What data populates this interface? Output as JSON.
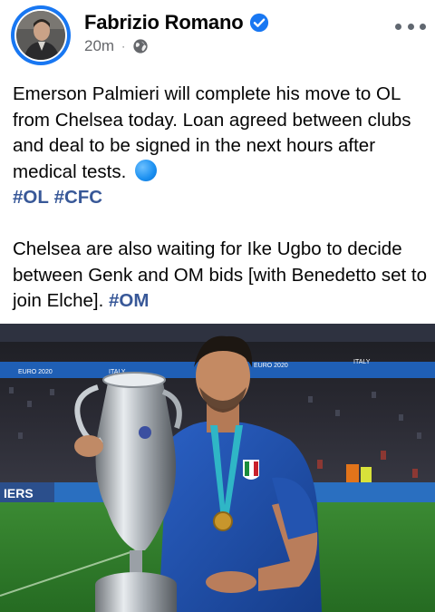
{
  "post": {
    "author": "Fabrizio Romano",
    "timestamp": "20m",
    "separator": "·",
    "privacy_icon": "globe-icon",
    "verified_icon": "verified-badge-icon",
    "more_icon": "more-options-icon",
    "paragraph1": {
      "text": "Emerson Palmieri will complete his move to OL from Chelsea today. Loan agreed between clubs and deal to be signed in the next hours after medical tests.",
      "emoji": "blue-circle-emoji",
      "hashtags": [
        "#OL",
        "#CFC"
      ]
    },
    "paragraph2": {
      "text": "Chelsea are also waiting for Ike Ugbo to decide between Genk and OM bids [with Benedetto set to join Elche].",
      "hashtag": "#OM"
    }
  },
  "photo": {
    "board_text_1": "EURO 2020",
    "board_text_2": "ITALY",
    "board_text_3": "EURO 2020",
    "board_text_4": "ITALY",
    "lower_board_text": "IERS"
  },
  "colors": {
    "brand_blue": "#1877f2",
    "hashtag": "#385898",
    "meta_gray": "#65676b",
    "jersey_blue": "#1f4fa8",
    "pitch_green": "#2f7d2a"
  }
}
